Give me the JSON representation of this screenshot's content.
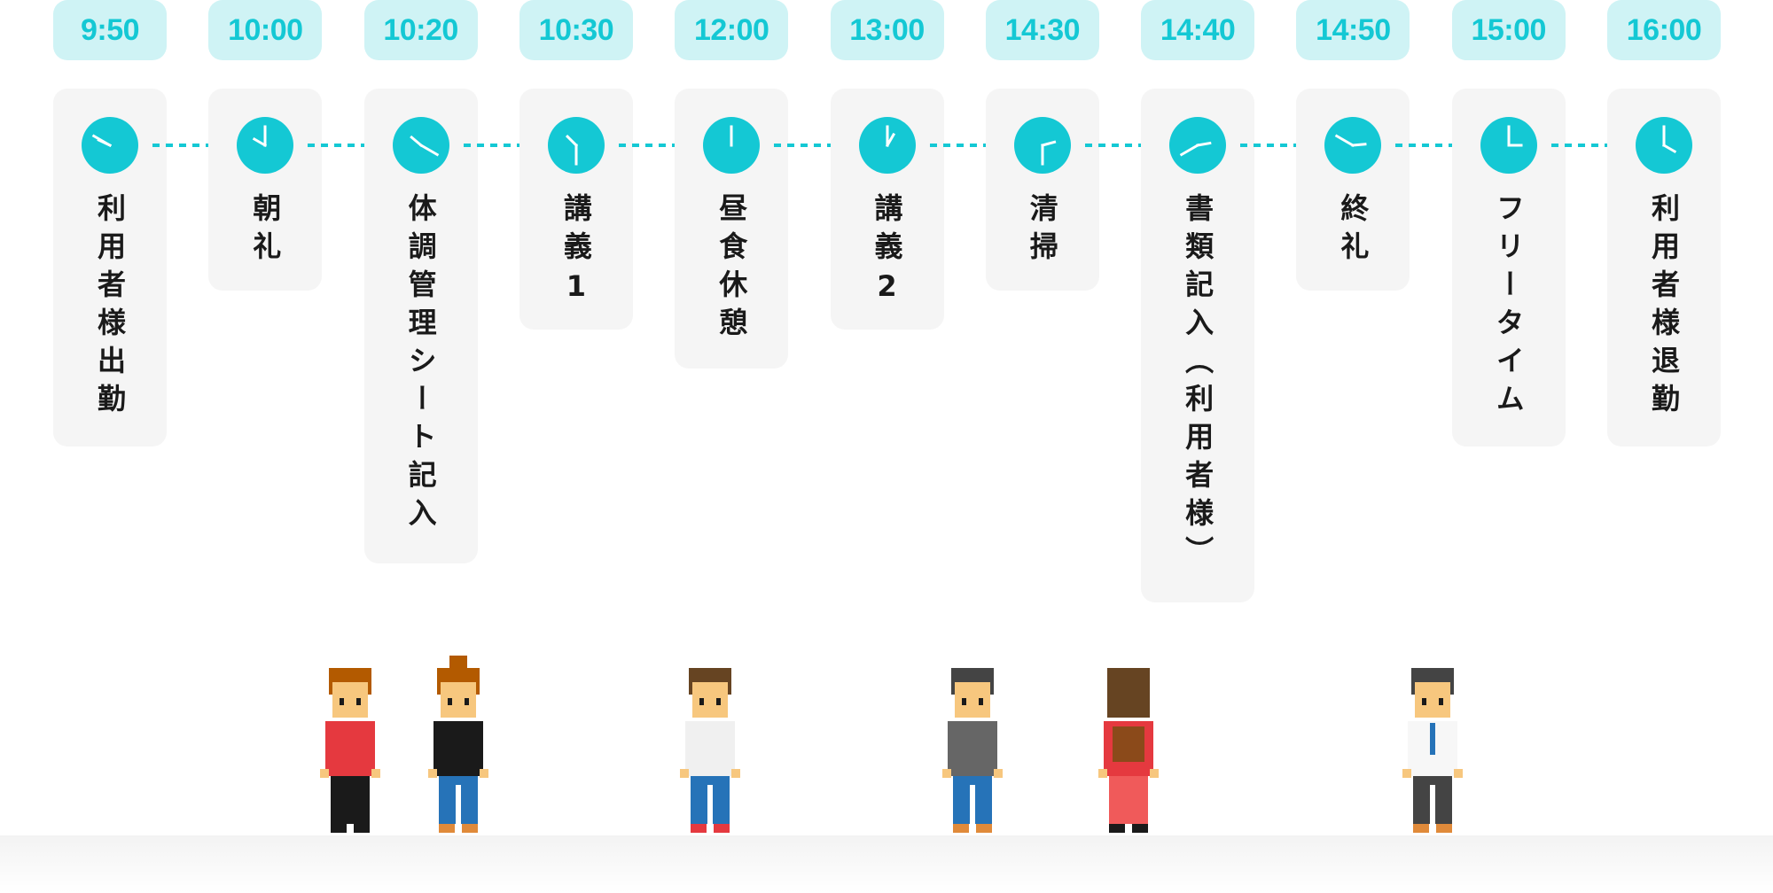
{
  "colors": {
    "accent": "#14c8d4",
    "pill_bg": "#cff3f5",
    "card_bg": "#f5f5f5",
    "text": "#1a1a1a"
  },
  "schedule": [
    {
      "time": "9:50",
      "label": "利用者様出勤",
      "icon": "clock-icon"
    },
    {
      "time": "10:00",
      "label": "朝礼",
      "icon": "clock-icon"
    },
    {
      "time": "10:20",
      "label": "体調管理シート記入",
      "icon": "clock-icon"
    },
    {
      "time": "10:30",
      "label": "講義1",
      "icon": "clock-icon"
    },
    {
      "time": "12:00",
      "label": "昼食休憩",
      "icon": "clock-icon"
    },
    {
      "time": "13:00",
      "label": "講義2",
      "icon": "clock-icon"
    },
    {
      "time": "14:30",
      "label": "清掃",
      "icon": "clock-icon"
    },
    {
      "time": "14:40",
      "label": "書類記入（利用者様）",
      "icon": "clock-icon"
    },
    {
      "time": "14:50",
      "label": "終礼",
      "icon": "clock-icon"
    },
    {
      "time": "15:00",
      "label": "フリータイム",
      "icon": "clock-icon"
    },
    {
      "time": "16:00",
      "label": "利用者様退勤",
      "icon": "clock-icon"
    }
  ],
  "figures": [
    {
      "name": "walking-woman-figure",
      "hair": "#b35a00",
      "top": "#e5393f",
      "bottom": "#1a1a1a",
      "shoes": "#1a1a1a"
    },
    {
      "name": "bun-woman-figure",
      "hair": "#b35a00",
      "top": "#1a1a1a",
      "bottom": "#2673b8",
      "shoes": "#e08a3a"
    },
    {
      "name": "waving-girl-figure",
      "hair": "#664422",
      "top": "#f0f0f0",
      "bottom": "#2673b8",
      "shoes": "#e5393f"
    },
    {
      "name": "man-gray-shirt-figure",
      "hair": "#444444",
      "top": "#666666",
      "bottom": "#2673b8",
      "shoes": "#e08a3a"
    },
    {
      "name": "backpack-girl-figure",
      "hair": "#664422",
      "top": "#e5393f",
      "bottom": "#f05a5a",
      "shoes": "#1a1a1a"
    },
    {
      "name": "man-tie-figure",
      "hair": "#444444",
      "top": "#f7f7f7",
      "bottom": "#444444",
      "shoes": "#e08a3a"
    }
  ]
}
